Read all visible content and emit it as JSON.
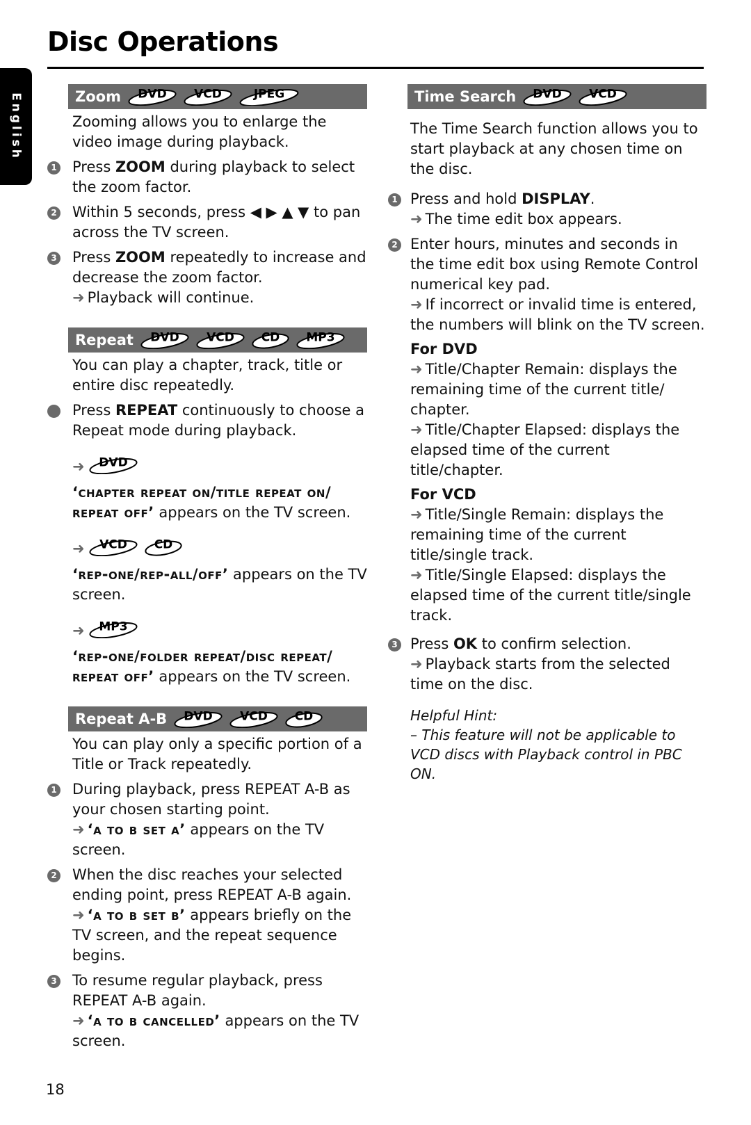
{
  "header": {
    "title": "Disc Operations",
    "language_tab": "English"
  },
  "page_number": "18",
  "colors": {
    "section_bar": "#6a6a6a",
    "text": "#111111"
  },
  "zoom": {
    "title": "Zoom",
    "badges": [
      "DVD",
      "VCD",
      "JPEG"
    ],
    "intro": "Zooming allows you to enlarge the video image during playback.",
    "steps": [
      {
        "n": "1",
        "pre": "Press ",
        "bold": "ZOOM",
        "post": " during playback to select the zoom factor."
      },
      {
        "n": "2",
        "pre": "Within 5 seconds, press ",
        "keys": "◀ ▶ ▲ ▼",
        "post": " to pan across the TV screen."
      },
      {
        "n": "3",
        "pre": "Press ",
        "bold": "ZOOM",
        "post": " repeatedly to increase and decrease the zoom factor.",
        "result": "Playback will continue."
      }
    ]
  },
  "repeat": {
    "title": "Repeat",
    "badges": [
      "DVD",
      "VCD",
      "CD",
      "MP3"
    ],
    "intro": "You can play a chapter, track, title or entire disc repeatedly.",
    "bullet": {
      "pre": "Press ",
      "bold": "REPEAT",
      "post": " continuously to choose a Repeat mode during playback."
    },
    "modes": [
      {
        "discs": [
          "DVD"
        ],
        "osd": "‘chapter repeat on/title repeat on/ repeat off’",
        "post": " appears on the TV screen."
      },
      {
        "discs": [
          "VCD",
          "CD"
        ],
        "osd": "‘rep-one/rep-all/off’",
        "post": " appears on the TV screen."
      },
      {
        "discs": [
          "MP3"
        ],
        "osd": "‘rep-one/folder repeat/disc repeat/ repeat off’",
        "post": " appears on the TV screen."
      }
    ]
  },
  "repeat_ab": {
    "title": "Repeat A-B",
    "badges": [
      "DVD",
      "VCD",
      "CD"
    ],
    "intro": "You can play only a specific portion of a Title or Track repeatedly.",
    "steps": [
      {
        "n": "1",
        "text": "During playback, press REPEAT A-B as your chosen starting point.",
        "osd": "‘a to b  set a’",
        "post": " appears on the TV screen."
      },
      {
        "n": "2",
        "text": "When the disc reaches your selected ending point, press REPEAT A-B again.",
        "osd": "‘a to b  set b’",
        "post": " appears briefly on the TV screen, and the repeat sequence begins."
      },
      {
        "n": "3",
        "text": "To resume regular playback, press REPEAT A-B again.",
        "osd": "‘a to b  cancelled’",
        "post": " appears on the TV screen."
      }
    ]
  },
  "time_search": {
    "title": "Time Search",
    "badges": [
      "DVD",
      "VCD"
    ],
    "intro": "The Time Search function allows you to start playback at any chosen time on the disc.",
    "step1": {
      "n": "1",
      "pre": "Press and hold ",
      "bold": "DISPLAY",
      "post": ".",
      "result": "The time edit box appears."
    },
    "step2": {
      "n": "2",
      "text": "Enter hours, minutes and seconds in the time edit box using Remote Control numerical key pad.",
      "result": "If incorrect or invalid time is entered, the numbers will blink on the TV screen."
    },
    "for_dvd": {
      "heading": "For DVD",
      "items": [
        "Title/Chapter Remain: displays the remaining time of the current title/ chapter.",
        "Title/Chapter Elapsed: displays the elapsed time of the current title/chapter."
      ]
    },
    "for_vcd": {
      "heading": "For VCD",
      "items": [
        "Title/Single Remain: displays the remaining time of the current title/single track.",
        "Title/Single Elapsed: displays the elapsed time of the current title/single track."
      ]
    },
    "step3": {
      "n": "3",
      "pre": "Press ",
      "bold": "OK",
      "post": " to confirm selection.",
      "result": "Playback starts from the selected time on the disc."
    },
    "hint": {
      "heading": "Helpful Hint:",
      "text": "–    This feature will not be applicable to VCD discs with Playback control in PBC ON."
    }
  },
  "arrow_glyph": "➜"
}
